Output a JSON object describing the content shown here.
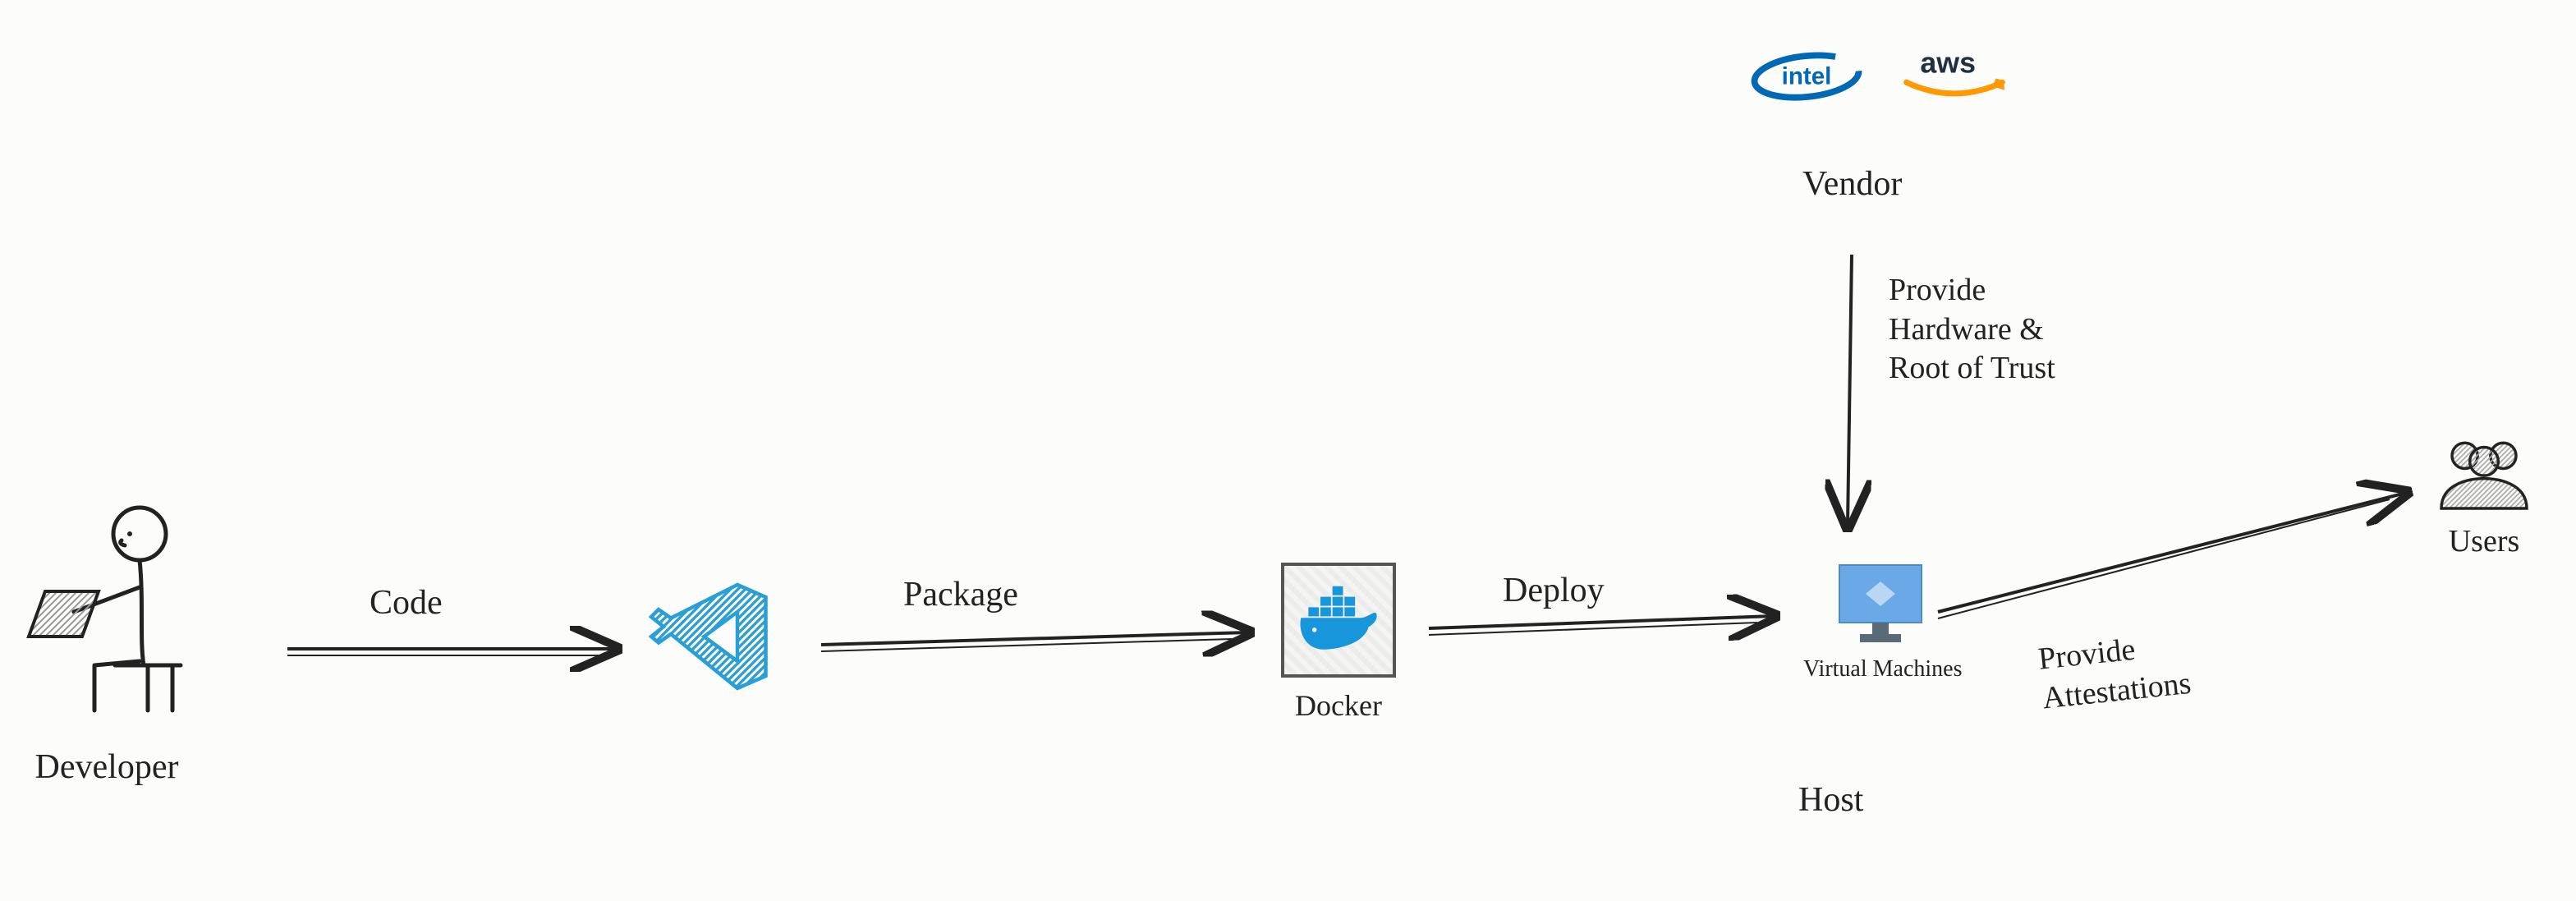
{
  "nodes": {
    "developer": {
      "label": "Developer"
    },
    "vscode": {
      "label": ""
    },
    "docker": {
      "label": "Docker"
    },
    "vm": {
      "label": "Virtual\nMachines",
      "role": "Host"
    },
    "vendor": {
      "label": "Vendor",
      "logos": [
        "intel",
        "aws"
      ]
    },
    "users": {
      "label": "Users"
    }
  },
  "edges": {
    "code": {
      "label": "Code"
    },
    "package": {
      "label": "Package"
    },
    "deploy": {
      "label": "Deploy"
    },
    "provide_hw": {
      "label": "Provide\nHardware &\nRoot of Trust"
    },
    "attest": {
      "label": "Provide\nAttestations"
    }
  },
  "colors": {
    "intel_blue": "#0068b5",
    "aws_orange": "#ff9900",
    "aws_text": "#232f3e",
    "vscode_blue": "#2a9fd6",
    "docker_blue": "#1896dc",
    "azure_blue": "#4a8cd1",
    "azure_dark": "#5a6a78"
  }
}
